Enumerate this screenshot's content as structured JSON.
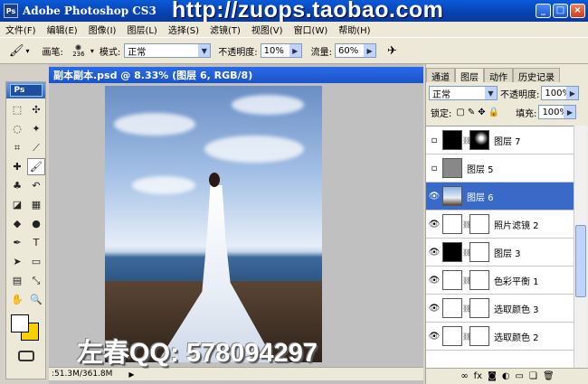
{
  "window": {
    "app_icon": "Ps",
    "title": "Adobe Photoshop CS3",
    "watermark_url": "http://zuops.taobao.com",
    "minimize_label": "_",
    "maximize_label": "□",
    "close_label": "×"
  },
  "menu": [
    "文件(F)",
    "编辑(E)",
    "图像(I)",
    "图层(L)",
    "选择(S)",
    "滤镜(T)",
    "视图(V)",
    "窗口(W)",
    "帮助(H)"
  ],
  "options": {
    "brush_label": "画笔:",
    "brush_size": "236",
    "mode_label": "模式:",
    "mode_value": "正常",
    "opacity_label": "不透明度:",
    "opacity_value": "10%",
    "flow_label": "流量:",
    "flow_value": "60%"
  },
  "toolbox": {
    "logo": "Ps",
    "tools": [
      "marquee-icon",
      "move-icon",
      "lasso-icon",
      "magic-wand-icon",
      "crop-icon",
      "slice-icon",
      "healing-icon",
      "brush-icon",
      "stamp-icon",
      "history-brush-icon",
      "eraser-icon",
      "gradient-icon",
      "blur-icon",
      "dodge-icon",
      "pen-icon",
      "type-icon",
      "path-select-icon",
      "shape-icon",
      "notes-icon",
      "eyedropper-icon",
      "hand-icon",
      "zoom-icon"
    ],
    "active_tool": "brush-icon",
    "foreground_color": "#ffffff",
    "background_color": "#f8d000"
  },
  "document": {
    "title": "副本副本.psd @ 8.33% (图层 6, RGB/8)",
    "status": ":51.3M/361.8M",
    "watermark_qq": "左春QQ: 578094297"
  },
  "panel": {
    "tabs": [
      "通道",
      "图层",
      "动作",
      "历史记录"
    ],
    "active_tab": "图层",
    "blend_mode": "正常",
    "opacity_label": "不透明度:",
    "opacity_value": "100%",
    "lock_label": "锁定:",
    "fill_label": "填充:",
    "fill_value": "100%",
    "layers": [
      {
        "name": "图层 7",
        "visible": false,
        "selected": false,
        "has_mask": true
      },
      {
        "name": "图层 5",
        "visible": false,
        "selected": false,
        "has_mask": false
      },
      {
        "name": "图层 6",
        "visible": true,
        "selected": true,
        "has_mask": false
      },
      {
        "name": "照片滤镜 2",
        "visible": true,
        "selected": false,
        "has_mask": true
      },
      {
        "name": "图层 3",
        "visible": true,
        "selected": false,
        "has_mask": true
      },
      {
        "name": "色彩平衡 1",
        "visible": true,
        "selected": false,
        "has_mask": true
      },
      {
        "name": "选取颜色 3",
        "visible": true,
        "selected": false,
        "has_mask": true
      },
      {
        "name": "选取颜色 2",
        "visible": true,
        "selected": false,
        "has_mask": true
      }
    ]
  }
}
